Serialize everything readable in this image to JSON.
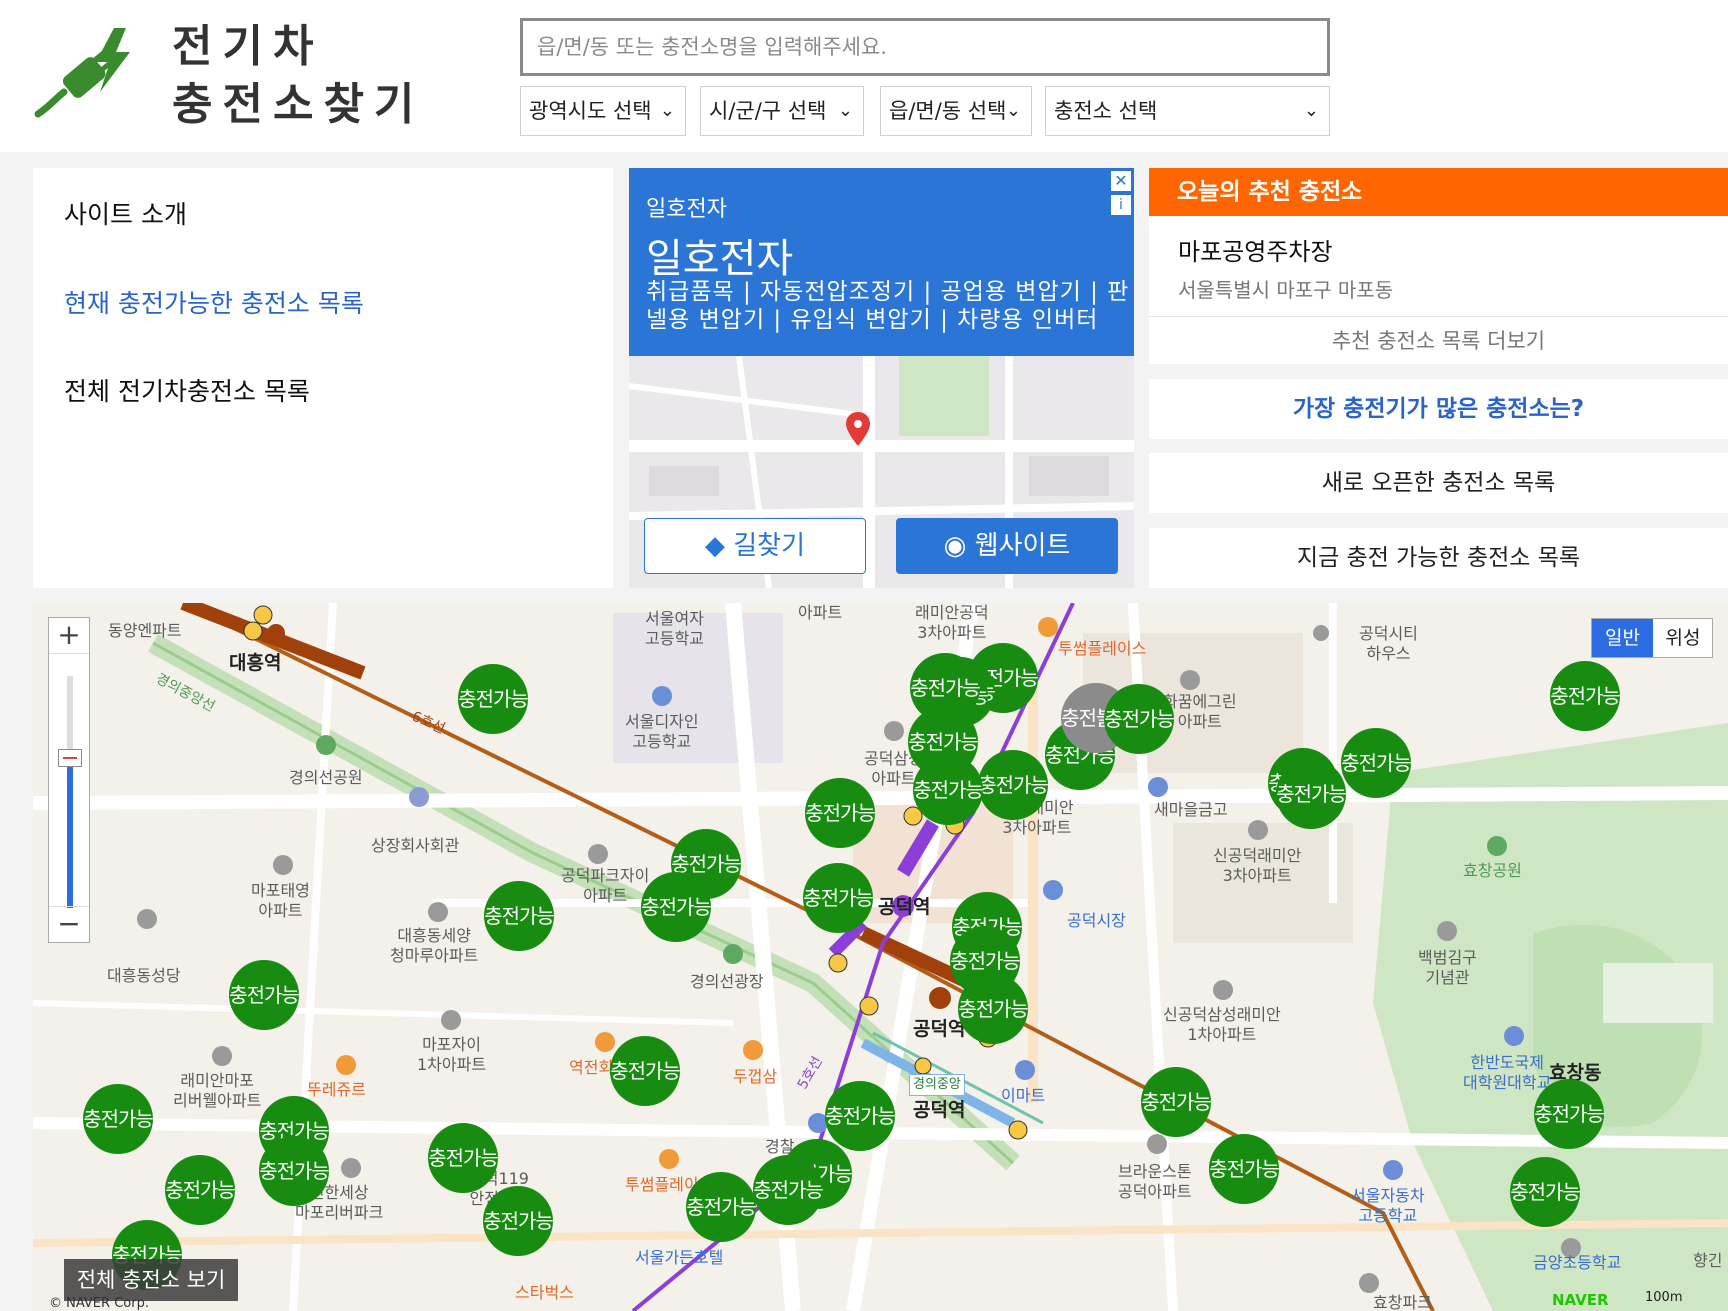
{
  "header": {
    "logo_line1": "전기차",
    "logo_line2": "충전소찾기",
    "search_placeholder": "읍/면/동 또는 충전소명을 입력해주세요.",
    "selects": [
      "광역시도 선택",
      "시/군/구 선택",
      "읍/면/동 선택",
      "충전소 선택"
    ]
  },
  "left_nav": {
    "items": [
      "사이트 소개",
      "현재 충전가능한 충전소 목록",
      "전체 전기차충전소 목록"
    ]
  },
  "ad": {
    "small_title": "일호전자",
    "title": "일호전자",
    "description": "취급품목 | 자동전압조정기 | 공업용 변압기 | 판넬용 변압기 | 유입식 변압기 | 차량용 인버터",
    "route_button": "길찾기",
    "website_button": "웹사이트"
  },
  "recommend": {
    "header": "오늘의 추천 충전소",
    "name": "마포공영주차장",
    "address": "서울특별시 마포구 마포동",
    "more": "추천 충전소 목록 더보기"
  },
  "right_buttons": [
    "가장 충전기가 많은 충전소는?",
    "새로 오픈한 충전소 목록",
    "지금 충전 가능한 충전소 목록"
  ],
  "map": {
    "labels": {
      "daeheung": "대흥역",
      "gongdeok_main": "공덕역",
      "gongdeok_s": "공덕역",
      "gongdeok_gj": "공덕역",
      "gyeongui_chip": "경의중앙",
      "line6_a": "6호선",
      "line5": "5호선",
      "gyeongui_line": "경의중앙선",
      "dongyang": "동양엔파트",
      "gyeongui_park": "경의선공원",
      "sangjang": "상장회사회관",
      "mapo_taeyoung": "마포태영\n아파트",
      "daeheung_cath": "대흥동성당",
      "daeheung_seyang": "대흥동세양\n청마루아파트",
      "mapo_xi": "마포자이\n1차아파트",
      "raemian_mapo": "래미안마포\n리버웰아파트",
      "ttureju": "뚜레쥬르",
      "sinhan": "신한세상\n마포리버파크",
      "seoul_girls": "서울여자\n고등학교",
      "seoul_design": "서울디자인\n고등학교",
      "apt_top": "아파트",
      "raemian3_top": "래미안공덕\n3차아파트",
      "gongdeok_samsung": "공덕삼성\n아파트",
      "gongdeok_park": "공덕파크자이\n아파트",
      "gyeongui_square": "경의선광장",
      "yeokjeon": "역전회",
      "dukpsam": "두껍삼",
      "twosome_top": "투썸플레이스",
      "gongdeok_green": "공덕래미안\n3차아파트",
      "hwaggum": "화꿈에그린\n아파트",
      "saemaeul": "새마을금고",
      "gongdeok_market": "공덕시장",
      "sin_gongdeok3": "신공덕래미안\n3차아파트",
      "sin_gongdeok1": "신공덕삼성래미안\n1차아파트",
      "emart": "이마트",
      "brownstone": "브라운스톤\n공덕아파트",
      "gongdeok_city": "공덕시티\n하우스",
      "hyochang_park": "효창공원",
      "baekbeom": "백범김구\n기념관",
      "hanban": "한반도국제\n대학원대학교",
      "hyochang_dong": "효창동",
      "seoul_auto": "서울자동차\n고등학교",
      "geumyang": "금양초등학교",
      "twosome_bottom": "투썸플레이스",
      "seoul_garden": "서울가든호텔",
      "starbucks": "스타벅스",
      "gongdeok119": "공덕119\n안전센터",
      "hyochang_park2": "효창파크",
      "hyanggin": "향긴",
      "gyeongchal": "경찰"
    },
    "markers": [
      {
        "label": "충전가능",
        "status": "available"
      },
      {
        "label": "충전가능",
        "status": "available"
      },
      {
        "label": "충전가능",
        "status": "available"
      },
      {
        "label": "충전가능",
        "status": "available"
      },
      {
        "label": "충전가능",
        "status": "available"
      },
      {
        "label": "충전가능",
        "status": "available"
      },
      {
        "label": "충전가능",
        "status": "available"
      },
      {
        "label": "충전가능",
        "status": "available"
      },
      {
        "label": "충전가능",
        "status": "available"
      },
      {
        "label": "충전가능",
        "status": "available"
      },
      {
        "label": "충전가능",
        "status": "available"
      },
      {
        "label": "충전가능",
        "status": "available"
      },
      {
        "label": "충전가능",
        "status": "available"
      },
      {
        "label": "충전가능",
        "status": "available"
      },
      {
        "label": "충전가능",
        "status": "available"
      },
      {
        "label": "충전가능",
        "status": "available"
      },
      {
        "label": "충전가능",
        "status": "available"
      },
      {
        "label": "충전가능",
        "status": "available"
      },
      {
        "label": "충전가능",
        "status": "available"
      },
      {
        "label": "충전불가",
        "status": "unavailable"
      },
      {
        "label": "충전가능",
        "status": "available"
      },
      {
        "label": "충전가능",
        "status": "available"
      },
      {
        "label": "충전가능",
        "status": "available"
      },
      {
        "label": "충전가능",
        "status": "available"
      },
      {
        "label": "충전가능",
        "status": "available"
      },
      {
        "label": "충전가능",
        "status": "available"
      },
      {
        "label": "충전가능",
        "status": "available"
      },
      {
        "label": "충전가능",
        "status": "available"
      },
      {
        "label": "충전가능",
        "status": "available"
      },
      {
        "label": "충전가능",
        "status": "available"
      },
      {
        "label": "충전가능",
        "status": "available"
      },
      {
        "label": "충전가능",
        "status": "available"
      },
      {
        "label": "충전가능",
        "status": "available"
      },
      {
        "label": "충전가능",
        "status": "available"
      },
      {
        "label": "충전가능",
        "status": "available"
      },
      {
        "label": "충전가능",
        "status": "available"
      },
      {
        "label": "충전가능",
        "status": "available"
      },
      {
        "label": "충전가능",
        "status": "available"
      },
      {
        "label": "충전가능",
        "status": "available"
      }
    ],
    "zoom_in": "+",
    "zoom_out": "−",
    "maptype_normal": "일반",
    "maptype_satellite": "위성",
    "view_all": "전체 충전소 보기",
    "copyright": "© NAVER Corp.",
    "naver": "NAVER",
    "scale": "100m"
  },
  "colors": {
    "accent_blue": "#2a75d6",
    "recommend_orange": "#ff6600",
    "marker_green": "#188c11",
    "marker_gray": "#8b8b8b"
  }
}
